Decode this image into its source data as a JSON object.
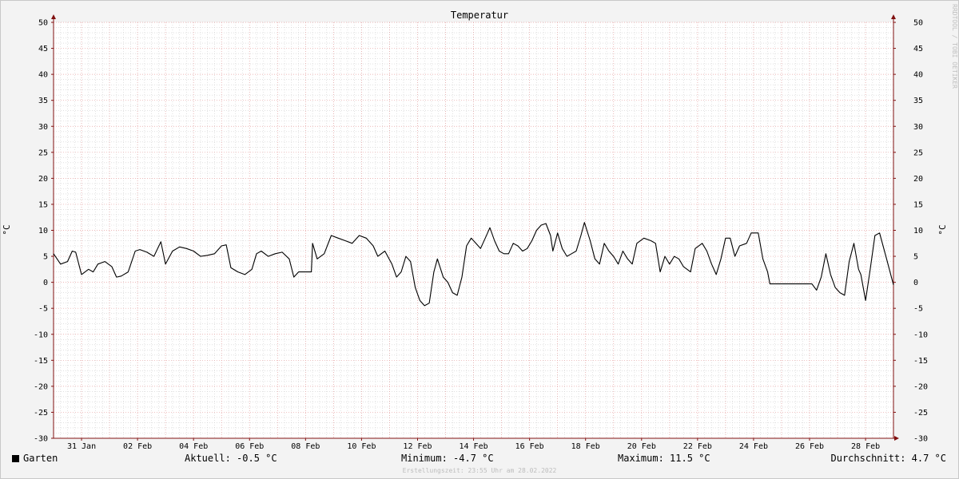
{
  "chart_data": {
    "type": "line",
    "title": "Temperatur",
    "ylabel": "°C",
    "ylabel_right": "°C",
    "ylim": [
      -30,
      50
    ],
    "y_ticks": [
      50,
      45,
      40,
      35,
      30,
      25,
      20,
      15,
      10,
      5,
      0,
      -5,
      -10,
      -15,
      -20,
      -25,
      -30
    ],
    "xlim": [
      "2022-01-30T00:00",
      "2022-02-28T23:55"
    ],
    "x_ticks": [
      {
        "date": "2022-01-31T00:00",
        "label": "31 Jan"
      },
      {
        "date": "2022-02-02T00:00",
        "label": "02 Feb"
      },
      {
        "date": "2022-02-04T00:00",
        "label": "04 Feb"
      },
      {
        "date": "2022-02-06T00:00",
        "label": "06 Feb"
      },
      {
        "date": "2022-02-08T00:00",
        "label": "08 Feb"
      },
      {
        "date": "2022-02-10T00:00",
        "label": "10 Feb"
      },
      {
        "date": "2022-02-12T00:00",
        "label": "12 Feb"
      },
      {
        "date": "2022-02-14T00:00",
        "label": "14 Feb"
      },
      {
        "date": "2022-02-16T00:00",
        "label": "16 Feb"
      },
      {
        "date": "2022-02-18T00:00",
        "label": "18 Feb"
      },
      {
        "date": "2022-02-20T00:00",
        "label": "20 Feb"
      },
      {
        "date": "2022-02-22T00:00",
        "label": "22 Feb"
      },
      {
        "date": "2022-02-24T00:00",
        "label": "24 Feb"
      },
      {
        "date": "2022-02-26T00:00",
        "label": "26 Feb"
      },
      {
        "date": "2022-02-28T00:00",
        "label": "28 Feb"
      }
    ],
    "grid": true,
    "series": [
      {
        "name": "Garten",
        "color": "#000000",
        "points": [
          [
            "2022-01-30T00:00",
            5.5
          ],
          [
            "2022-01-30T06:00",
            3.5
          ],
          [
            "2022-01-30T12:00",
            4.0
          ],
          [
            "2022-01-30T16:00",
            6.0
          ],
          [
            "2022-01-30T19:00",
            5.8
          ],
          [
            "2022-01-31T00:00",
            1.5
          ],
          [
            "2022-01-31T06:00",
            2.5
          ],
          [
            "2022-01-31T10:00",
            2.0
          ],
          [
            "2022-01-31T14:00",
            3.5
          ],
          [
            "2022-01-31T20:00",
            4.0
          ],
          [
            "2022-02-01T02:00",
            3.0
          ],
          [
            "2022-02-01T06:00",
            1.0
          ],
          [
            "2022-02-01T10:00",
            1.2
          ],
          [
            "2022-02-01T16:00",
            2.0
          ],
          [
            "2022-02-01T22:00",
            6.0
          ],
          [
            "2022-02-02T02:00",
            6.3
          ],
          [
            "2022-02-02T08:00",
            5.8
          ],
          [
            "2022-02-02T14:00",
            5.0
          ],
          [
            "2022-02-02T20:00",
            7.8
          ],
          [
            "2022-02-03T00:00",
            3.5
          ],
          [
            "2022-02-03T06:00",
            6.0
          ],
          [
            "2022-02-03T12:00",
            6.8
          ],
          [
            "2022-02-03T18:00",
            6.5
          ],
          [
            "2022-02-04T00:00",
            6.0
          ],
          [
            "2022-02-04T06:00",
            5.0
          ],
          [
            "2022-02-04T12:00",
            5.2
          ],
          [
            "2022-02-04T18:00",
            5.5
          ],
          [
            "2022-02-05T00:00",
            7.0
          ],
          [
            "2022-02-05T04:00",
            7.2
          ],
          [
            "2022-02-05T08:00",
            2.8
          ],
          [
            "2022-02-05T14:00",
            2.0
          ],
          [
            "2022-02-05T20:00",
            1.5
          ],
          [
            "2022-02-06T02:00",
            2.5
          ],
          [
            "2022-02-06T06:00",
            5.5
          ],
          [
            "2022-02-06T10:00",
            6.0
          ],
          [
            "2022-02-06T16:00",
            5.0
          ],
          [
            "2022-02-06T22:00",
            5.5
          ],
          [
            "2022-02-07T04:00",
            5.8
          ],
          [
            "2022-02-07T10:00",
            4.5
          ],
          [
            "2022-02-07T14:00",
            1.0
          ],
          [
            "2022-02-07T18:00",
            2.0
          ],
          [
            "2022-02-07T22:00",
            2.0
          ],
          [
            "2022-02-08T05:00",
            2.0
          ],
          [
            "2022-02-08T06:00",
            7.5
          ],
          [
            "2022-02-08T10:00",
            4.5
          ],
          [
            "2022-02-08T16:00",
            5.5
          ],
          [
            "2022-02-08T22:00",
            9.0
          ],
          [
            "2022-02-09T04:00",
            8.5
          ],
          [
            "2022-02-09T10:00",
            8.0
          ],
          [
            "2022-02-09T16:00",
            7.5
          ],
          [
            "2022-02-09T22:00",
            9.0
          ],
          [
            "2022-02-10T04:00",
            8.5
          ],
          [
            "2022-02-10T10:00",
            7.0
          ],
          [
            "2022-02-10T14:00",
            5.0
          ],
          [
            "2022-02-10T20:00",
            6.0
          ],
          [
            "2022-02-11T02:00",
            3.5
          ],
          [
            "2022-02-11T06:00",
            1.0
          ],
          [
            "2022-02-11T10:00",
            2.0
          ],
          [
            "2022-02-11T14:00",
            5.0
          ],
          [
            "2022-02-11T18:00",
            4.0
          ],
          [
            "2022-02-11T22:00",
            -1.0
          ],
          [
            "2022-02-12T02:00",
            -3.5
          ],
          [
            "2022-02-12T06:00",
            -4.5
          ],
          [
            "2022-02-12T10:00",
            -4.0
          ],
          [
            "2022-02-12T14:00",
            2.0
          ],
          [
            "2022-02-12T17:00",
            4.5
          ],
          [
            "2022-02-12T22:00",
            1.0
          ],
          [
            "2022-02-13T02:00",
            0.0
          ],
          [
            "2022-02-13T06:00",
            -2.0
          ],
          [
            "2022-02-13T10:00",
            -2.5
          ],
          [
            "2022-02-13T14:00",
            1.0
          ],
          [
            "2022-02-13T18:00",
            7.0
          ],
          [
            "2022-02-13T22:00",
            8.5
          ],
          [
            "2022-02-14T02:00",
            7.5
          ],
          [
            "2022-02-14T06:00",
            6.5
          ],
          [
            "2022-02-14T10:00",
            8.5
          ],
          [
            "2022-02-14T14:00",
            10.5
          ],
          [
            "2022-02-14T18:00",
            8.0
          ],
          [
            "2022-02-14T22:00",
            6.0
          ],
          [
            "2022-02-15T02:00",
            5.5
          ],
          [
            "2022-02-15T06:00",
            5.5
          ],
          [
            "2022-02-15T10:00",
            7.5
          ],
          [
            "2022-02-15T14:00",
            7.0
          ],
          [
            "2022-02-15T18:00",
            6.0
          ],
          [
            "2022-02-15T22:00",
            6.5
          ],
          [
            "2022-02-16T02:00",
            8.0
          ],
          [
            "2022-02-16T06:00",
            10.0
          ],
          [
            "2022-02-16T10:00",
            11.0
          ],
          [
            "2022-02-16T14:00",
            11.3
          ],
          [
            "2022-02-16T18:00",
            9.0
          ],
          [
            "2022-02-16T20:00",
            6.0
          ],
          [
            "2022-02-17T00:00",
            9.5
          ],
          [
            "2022-02-17T04:00",
            6.5
          ],
          [
            "2022-02-17T08:00",
            5.0
          ],
          [
            "2022-02-17T12:00",
            5.5
          ],
          [
            "2022-02-17T16:00",
            6.0
          ],
          [
            "2022-02-17T20:00",
            9.0
          ],
          [
            "2022-02-17T23:00",
            11.5
          ],
          [
            "2022-02-18T04:00",
            8.0
          ],
          [
            "2022-02-18T08:00",
            4.5
          ],
          [
            "2022-02-18T12:00",
            3.5
          ],
          [
            "2022-02-18T16:00",
            7.5
          ],
          [
            "2022-02-18T20:00",
            6.0
          ],
          [
            "2022-02-19T00:00",
            5.0
          ],
          [
            "2022-02-19T04:00",
            3.5
          ],
          [
            "2022-02-19T08:00",
            6.0
          ],
          [
            "2022-02-19T12:00",
            4.5
          ],
          [
            "2022-02-19T16:00",
            3.5
          ],
          [
            "2022-02-19T20:00",
            7.5
          ],
          [
            "2022-02-20T02:00",
            8.5
          ],
          [
            "2022-02-20T08:00",
            8.0
          ],
          [
            "2022-02-20T12:00",
            7.5
          ],
          [
            "2022-02-20T16:00",
            2.0
          ],
          [
            "2022-02-20T20:00",
            5.0
          ],
          [
            "2022-02-21T00:00",
            3.5
          ],
          [
            "2022-02-21T04:00",
            5.0
          ],
          [
            "2022-02-21T08:00",
            4.5
          ],
          [
            "2022-02-21T12:00",
            3.0
          ],
          [
            "2022-02-21T18:00",
            2.0
          ],
          [
            "2022-02-21T22:00",
            6.5
          ],
          [
            "2022-02-22T04:00",
            7.5
          ],
          [
            "2022-02-22T08:00",
            6.0
          ],
          [
            "2022-02-22T12:00",
            3.5
          ],
          [
            "2022-02-22T16:00",
            1.5
          ],
          [
            "2022-02-22T20:00",
            4.5
          ],
          [
            "2022-02-23T00:00",
            8.5
          ],
          [
            "2022-02-23T04:00",
            8.5
          ],
          [
            "2022-02-23T08:00",
            5.0
          ],
          [
            "2022-02-23T12:00",
            7.0
          ],
          [
            "2022-02-23T18:00",
            7.5
          ],
          [
            "2022-02-23T22:00",
            9.5
          ],
          [
            "2022-02-24T04:00",
            9.5
          ],
          [
            "2022-02-24T08:00",
            4.5
          ],
          [
            "2022-02-24T12:00",
            2.0
          ],
          [
            "2022-02-24T14:00",
            -0.3
          ],
          [
            "2022-02-24T20:00",
            -0.3
          ],
          [
            "2022-02-25T04:00",
            -0.3
          ],
          [
            "2022-02-25T12:00",
            -0.3
          ],
          [
            "2022-02-25T20:00",
            -0.3
          ],
          [
            "2022-02-26T02:00",
            -0.3
          ],
          [
            "2022-02-26T06:00",
            -1.5
          ],
          [
            "2022-02-26T10:00",
            1.0
          ],
          [
            "2022-02-26T14:00",
            5.5
          ],
          [
            "2022-02-26T18:00",
            1.5
          ],
          [
            "2022-02-26T22:00",
            -1.0
          ],
          [
            "2022-02-27T02:00",
            -2.0
          ],
          [
            "2022-02-27T06:00",
            -2.5
          ],
          [
            "2022-02-27T10:00",
            4.0
          ],
          [
            "2022-02-27T14:00",
            7.5
          ],
          [
            "2022-02-27T18:00",
            2.5
          ],
          [
            "2022-02-27T20:00",
            1.5
          ],
          [
            "2022-02-28T00:00",
            -3.5
          ],
          [
            "2022-02-28T04:00",
            2.5
          ],
          [
            "2022-02-28T08:00",
            9.0
          ],
          [
            "2022-02-28T12:00",
            9.5
          ],
          [
            "2022-02-28T18:00",
            4.5
          ],
          [
            "2022-02-28T23:55",
            -0.5
          ]
        ]
      }
    ]
  },
  "legend": {
    "series_label": "Garten",
    "series_color": "#000000",
    "current": "Aktuell: -0.5 °C",
    "minimum": "Minimum: -4.7 °C",
    "maximum": "Maximum: 11.5 °C",
    "average": "Durchschnitt: 4.7 °C"
  },
  "footer": "Erstellungszeit: 23:55 Uhr am 28.02.2022",
  "watermark": "RRDTOOL / TOBI OETIKER",
  "colors": {
    "background": "#f3f3f3",
    "plot_background": "#ffffff",
    "major_grid": "#e7a0a0",
    "minor_grid": "#cfcfcf",
    "axis": "#801010"
  }
}
